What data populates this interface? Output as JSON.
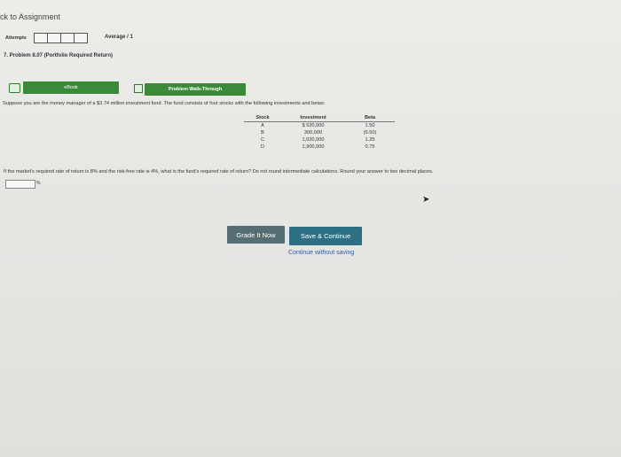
{
  "nav": {
    "back_link": "ck to Assignment"
  },
  "attempts": {
    "label": "Attempts",
    "average_label": "Average / 1"
  },
  "problem": {
    "title": "7. Problem 8.07 (Portfolio Required Return)"
  },
  "resources": {
    "ebook_label": "eBook",
    "walkthrough_label": "Problem Walk-Through"
  },
  "intro": "Suppose you are the money manager of a $3.74 million investment fund. The fund consists of four stocks with the following investments and betas:",
  "table": {
    "headers": [
      "Stock",
      "Investment",
      "Beta"
    ],
    "rows": [
      [
        "A",
        "$  520,000",
        "1.50"
      ],
      [
        "B",
        "300,000",
        "(0.50)"
      ],
      [
        "C",
        "1,020,000",
        "1.25"
      ],
      [
        "D",
        "1,900,000",
        "0.75"
      ]
    ]
  },
  "question": "If the market's required rate of return is 8% and the risk-free rate is 4%, what is the fund's required rate of return? Do not round intermediate calculations. Round your answer to two decimal places.",
  "answer": {
    "value": "",
    "unit": "%"
  },
  "buttons": {
    "grade": "Grade It Now",
    "save": "Save & Continue",
    "continue": "Continue without saving"
  },
  "icons": {
    "cursor": "arrow-pointer-icon",
    "ebook": "book-icon",
    "walkthrough": "video-icon"
  },
  "colors": {
    "green_button": "#3a8a3a",
    "grade_button": "#556e74",
    "save_button": "#2d6f84",
    "link": "#345b9a"
  }
}
